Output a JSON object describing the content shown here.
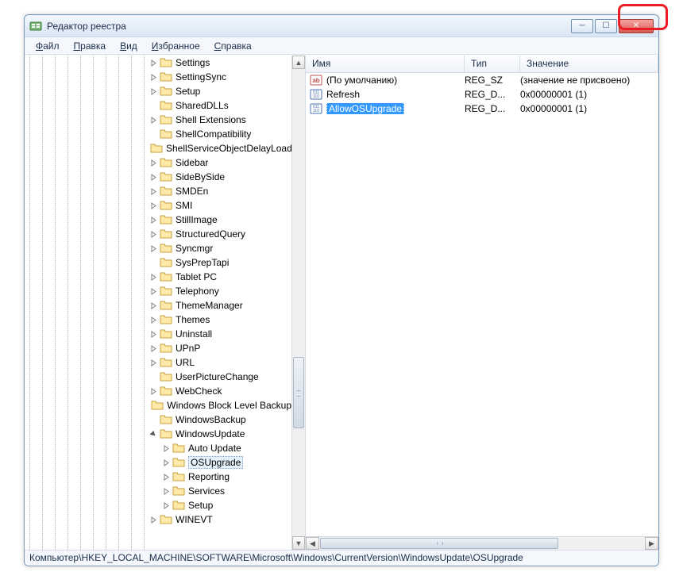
{
  "window": {
    "title": "Редактор реестра",
    "menus": [
      "Файл",
      "Правка",
      "Вид",
      "Избранное",
      "Справка"
    ],
    "status_path": "Компьютер\\HKEY_LOCAL_MACHINE\\SOFTWARE\\Microsoft\\Windows\\CurrentVersion\\WindowsUpdate\\OSUpgrade"
  },
  "tree": {
    "gutter_levels": 10,
    "items": [
      {
        "indent": 10,
        "exp": "closed",
        "label": "Settings"
      },
      {
        "indent": 10,
        "exp": "closed",
        "label": "SettingSync"
      },
      {
        "indent": 10,
        "exp": "closed",
        "label": "Setup"
      },
      {
        "indent": 10,
        "exp": "none",
        "label": "SharedDLLs"
      },
      {
        "indent": 10,
        "exp": "closed",
        "label": "Shell Extensions"
      },
      {
        "indent": 10,
        "exp": "none",
        "label": "ShellCompatibility"
      },
      {
        "indent": 10,
        "exp": "none",
        "label": "ShellServiceObjectDelayLoad"
      },
      {
        "indent": 10,
        "exp": "closed",
        "label": "Sidebar"
      },
      {
        "indent": 10,
        "exp": "closed",
        "label": "SideBySide"
      },
      {
        "indent": 10,
        "exp": "closed",
        "label": "SMDEn"
      },
      {
        "indent": 10,
        "exp": "closed",
        "label": "SMI"
      },
      {
        "indent": 10,
        "exp": "closed",
        "label": "StillImage"
      },
      {
        "indent": 10,
        "exp": "closed",
        "label": "StructuredQuery"
      },
      {
        "indent": 10,
        "exp": "closed",
        "label": "Syncmgr"
      },
      {
        "indent": 10,
        "exp": "none",
        "label": "SysPrepTapi"
      },
      {
        "indent": 10,
        "exp": "closed",
        "label": "Tablet PC"
      },
      {
        "indent": 10,
        "exp": "closed",
        "label": "Telephony"
      },
      {
        "indent": 10,
        "exp": "closed",
        "label": "ThemeManager"
      },
      {
        "indent": 10,
        "exp": "closed",
        "label": "Themes"
      },
      {
        "indent": 10,
        "exp": "closed",
        "label": "Uninstall"
      },
      {
        "indent": 10,
        "exp": "closed",
        "label": "UPnP"
      },
      {
        "indent": 10,
        "exp": "closed",
        "label": "URL"
      },
      {
        "indent": 10,
        "exp": "none",
        "label": "UserPictureChange"
      },
      {
        "indent": 10,
        "exp": "closed",
        "label": "WebCheck"
      },
      {
        "indent": 10,
        "exp": "none",
        "label": "Windows Block Level Backup"
      },
      {
        "indent": 10,
        "exp": "none",
        "label": "WindowsBackup"
      },
      {
        "indent": 10,
        "exp": "open",
        "label": "WindowsUpdate"
      },
      {
        "indent": 11,
        "exp": "closed",
        "label": "Auto Update"
      },
      {
        "indent": 11,
        "exp": "closed",
        "label": "OSUpgrade",
        "selected": true
      },
      {
        "indent": 11,
        "exp": "closed",
        "label": "Reporting"
      },
      {
        "indent": 11,
        "exp": "closed",
        "label": "Services"
      },
      {
        "indent": 11,
        "exp": "closed",
        "label": "Setup"
      },
      {
        "indent": 10,
        "exp": "closed",
        "label": "WINEVT"
      }
    ]
  },
  "list": {
    "columns": {
      "name": "Имя",
      "type": "Тип",
      "value": "Значение"
    },
    "rows": [
      {
        "icon": "sz",
        "name": "(По умолчанию)",
        "type": "REG_SZ",
        "value": "(значение не присвоено)"
      },
      {
        "icon": "dword",
        "name": "Refresh",
        "type": "REG_D...",
        "value": "0x00000001 (1)"
      },
      {
        "icon": "dword",
        "name": "AllowOSUpgrade",
        "type": "REG_D...",
        "value": "0x00000001 (1)",
        "selected": true
      }
    ]
  }
}
